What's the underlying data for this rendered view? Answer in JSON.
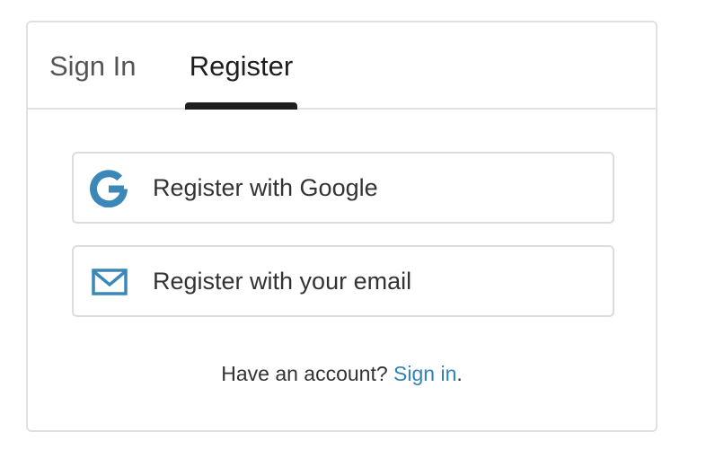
{
  "tabs": {
    "sign_in": "Sign In",
    "register": "Register",
    "active": "register"
  },
  "buttons": {
    "google": {
      "label": "Register with Google",
      "icon": "google-icon"
    },
    "email": {
      "label": "Register with your email",
      "icon": "mail-icon"
    }
  },
  "footer": {
    "prompt": "Have an account? ",
    "link": "Sign in",
    "suffix": "."
  },
  "colors": {
    "accent": "#2e83b7",
    "icon": "#3a87b8",
    "border": "#e1e1e1",
    "active_tab_indicator": "#1e1e1e",
    "text": "#333333"
  }
}
